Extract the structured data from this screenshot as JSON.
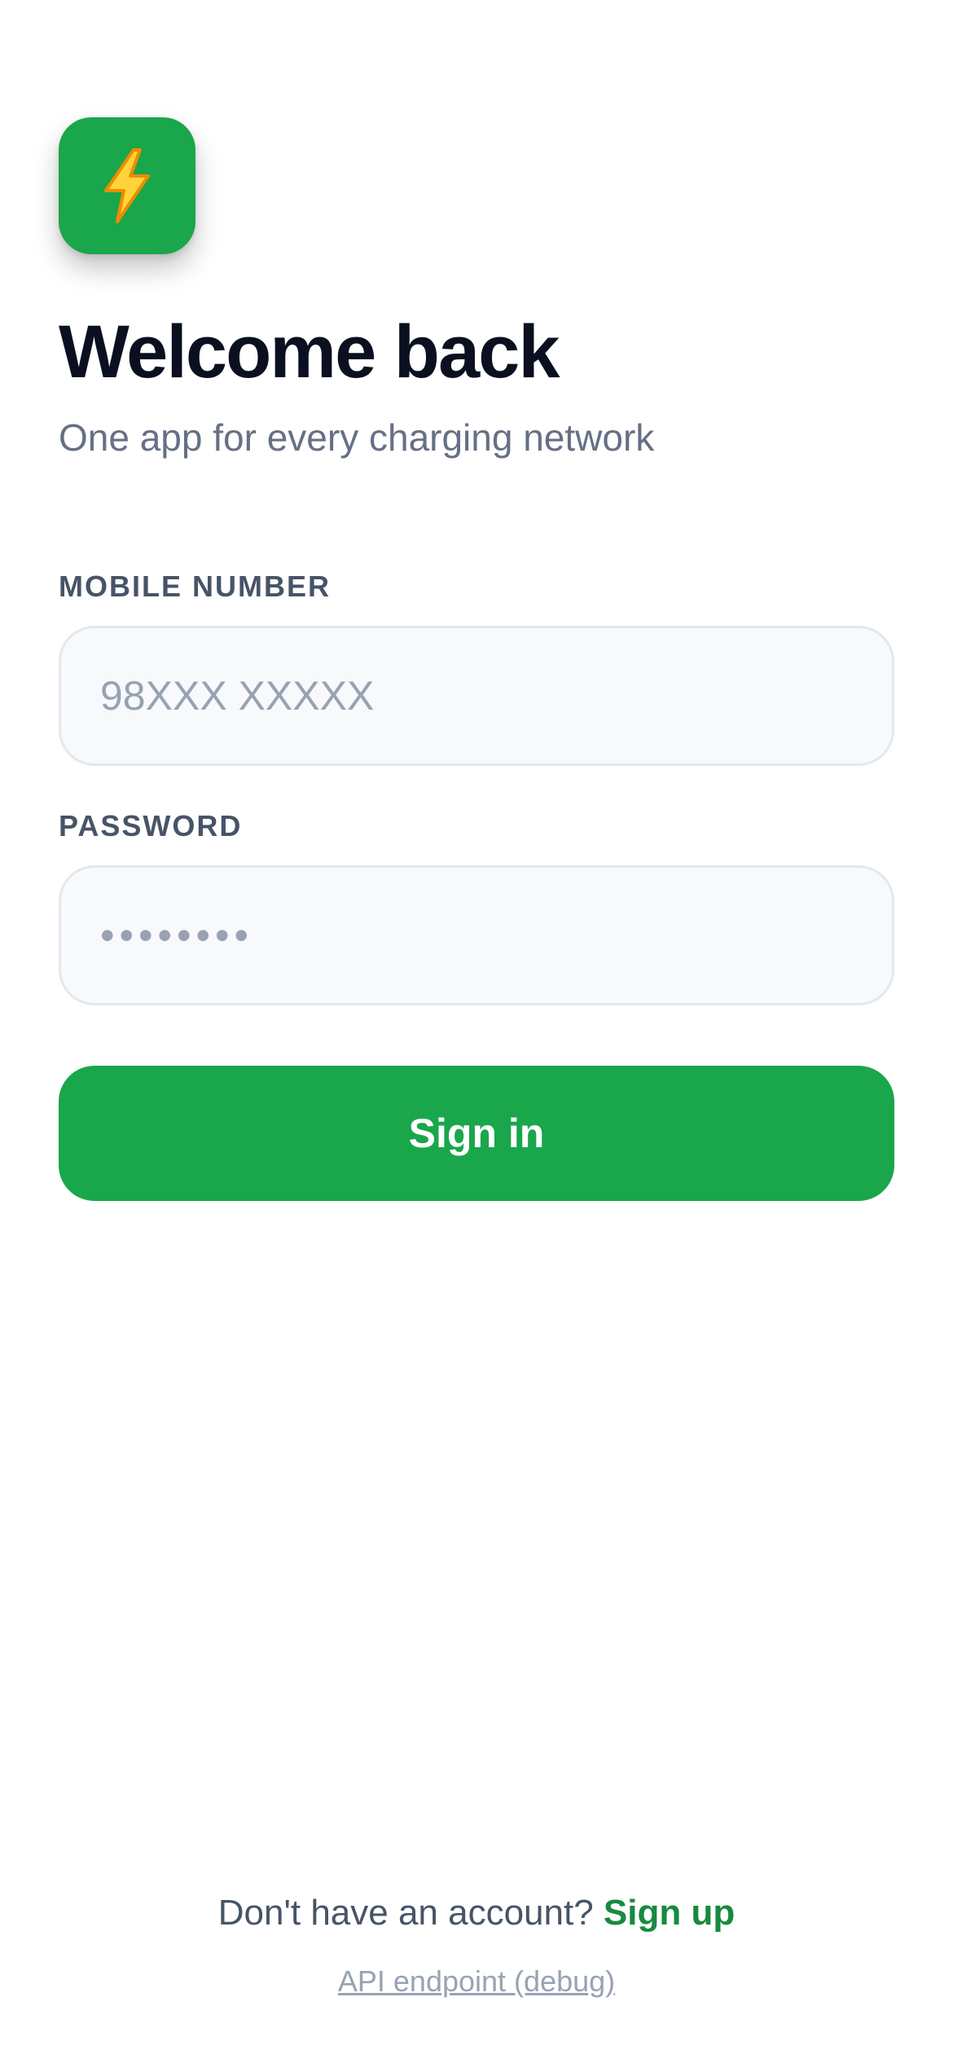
{
  "brand": {
    "icon": "lightning-bolt-icon",
    "color": "#1aa64b"
  },
  "header": {
    "title": "Welcome back",
    "subtitle": "One app for every charging network"
  },
  "form": {
    "mobile_label": "MOBILE NUMBER",
    "mobile_placeholder": "98XXX XXXXX",
    "mobile_value": "",
    "password_label": "PASSWORD",
    "password_placeholder": "••••••••",
    "password_value": "",
    "signin_label": "Sign in"
  },
  "footer": {
    "prompt": "Don't have an account?",
    "signup_label": "Sign up",
    "debug_label": "API endpoint (debug)"
  },
  "colors": {
    "accent": "#1aa64b",
    "link": "#178a3f",
    "text_primary": "#0b1020",
    "text_muted": "#667085"
  }
}
